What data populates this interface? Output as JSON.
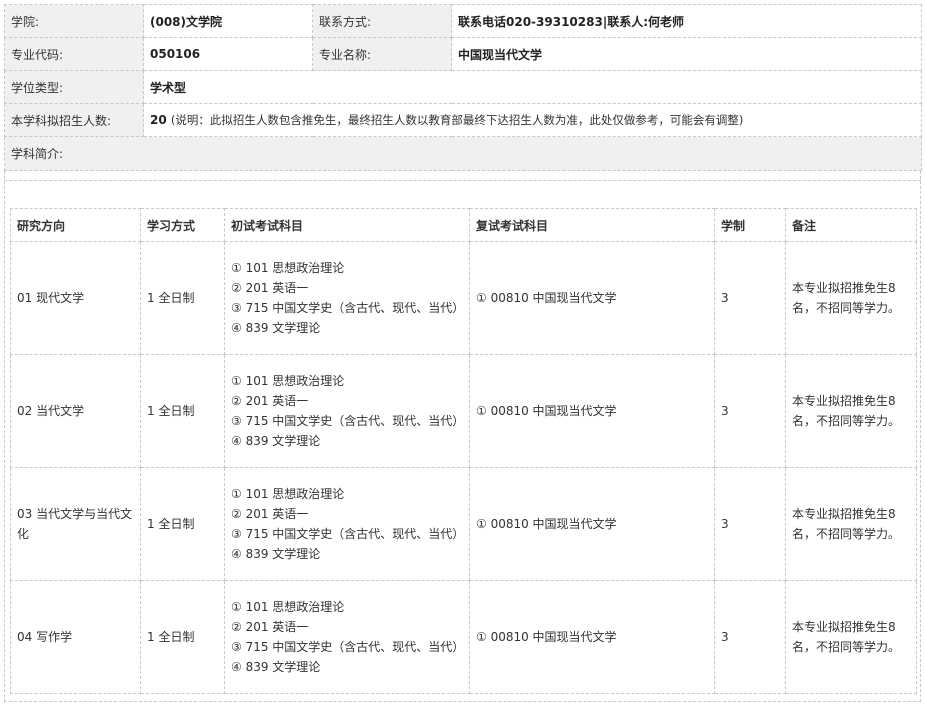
{
  "info": {
    "college_label": "学院:",
    "college_value": "(008)文学院",
    "contact_label": "联系方式:",
    "contact_value": "联系电话020-39310283|联系人:何老师",
    "major_code_label": "专业代码:",
    "major_code_value": "050106",
    "major_name_label": "专业名称:",
    "major_name_value": "中国现当代文学",
    "degree_type_label": "学位类型:",
    "degree_type_value": "学术型",
    "enroll_label": "本学科拟招生人数:",
    "enroll_number": "20",
    "enroll_note": "(说明：此拟招生人数包含推免生，最终招生人数以教育部最终下达招生人数为准，此处仅做参考，可能会有调整)",
    "intro_label": "学科简介:"
  },
  "table": {
    "headers": [
      "研究方向",
      "学习方式",
      "初试考试科目",
      "复试考试科目",
      "学制",
      "备注"
    ],
    "rows": [
      {
        "direction": "01 现代文学",
        "mode": "1 全日制",
        "exam": [
          "① 101 思想政治理论",
          "② 201 英语一",
          "③ 715 中国文学史（含古代、现代、当代）",
          "④ 839 文学理论"
        ],
        "retest": "① 00810 中国现当代文学",
        "years": "3",
        "note": "本专业拟招推免生8名，不招同等学力。"
      },
      {
        "direction": "02 当代文学",
        "mode": "1 全日制",
        "exam": [
          "① 101 思想政治理论",
          "② 201 英语一",
          "③ 715 中国文学史（含古代、现代、当代）",
          "④ 839 文学理论"
        ],
        "retest": "① 00810 中国现当代文学",
        "years": "3",
        "note": "本专业拟招推免生8名，不招同等学力。"
      },
      {
        "direction": "03 当代文学与当代文化",
        "mode": "1 全日制",
        "exam": [
          "① 101 思想政治理论",
          "② 201 英语一",
          "③ 715 中国文学史（含古代、现代、当代）",
          "④ 839 文学理论"
        ],
        "retest": "① 00810 中国现当代文学",
        "years": "3",
        "note": "本专业拟招推免生8名，不招同等学力。"
      },
      {
        "direction": "04 写作学",
        "mode": "1 全日制",
        "exam": [
          "① 101 思想政治理论",
          "② 201 英语一",
          "③ 715 中国文学史（含古代、现代、当代）",
          "④ 839 文学理论"
        ],
        "retest": "① 00810 中国现当代文学",
        "years": "3",
        "note": "本专业拟招推免生8名，不招同等学力。"
      }
    ]
  }
}
